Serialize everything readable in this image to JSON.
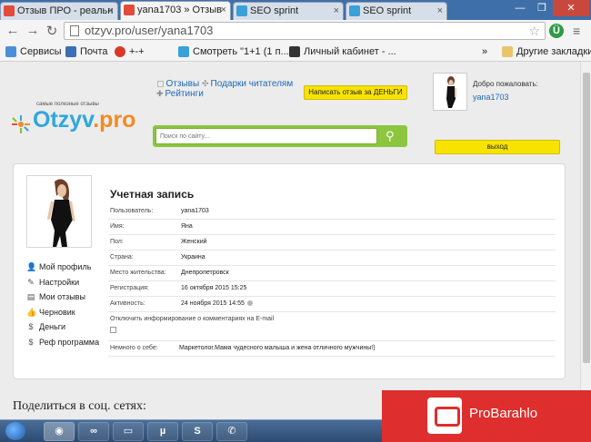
{
  "browser": {
    "tabs": [
      {
        "label": "Отзыв ПРО - реальн",
        "favicon_color": "#e24b3b",
        "active": false
      },
      {
        "label": "yana1703 » Отзыв",
        "favicon_color": "#e24b3b",
        "active": true
      },
      {
        "label": "SEO sprint",
        "favicon_color": "#3aa0d8",
        "active": false
      },
      {
        "label": "SEO sprint",
        "favicon_color": "#3aa0d8",
        "active": false
      }
    ],
    "url": "otzyv.pro/user/yana1703",
    "bookmarks": [
      {
        "label": "Сервисы",
        "color": "#4a8fdc"
      },
      {
        "label": "Почта",
        "color": "#3b6fb6"
      },
      {
        "label": "+-+",
        "color": "#d83a2a"
      },
      {
        "label": "Смотреть \"1+1 (1 п...",
        "color": "#3aa0d8"
      },
      {
        "label": "Личный кабинет - ...",
        "color": "#333333"
      }
    ],
    "other_bookmarks": "Другие закладки",
    "more": "»"
  },
  "site": {
    "logo_tagline": "самые полезные отзывы",
    "logo_main": "Otzyv",
    "logo_suffix": ".pro",
    "links": {
      "reviews": "Отзывы",
      "gifts": "Подарки читателям",
      "ratings": "Рейтинги"
    },
    "write_button": "Написать отзыв за ДЕНЬГИ",
    "welcome": "Добро пожаловать:",
    "welcome_user": "yana1703",
    "logout_button": "выход",
    "search_placeholder": "Поиск по сайту..."
  },
  "profile": {
    "title": "Учетная запись",
    "menu": [
      {
        "label": "Мой профиль",
        "icon": "user-icon"
      },
      {
        "label": "Настройки",
        "icon": "wrench-icon"
      },
      {
        "label": "Мои отзывы",
        "icon": "reviews-icon"
      },
      {
        "label": "Черновик",
        "icon": "draft-icon"
      },
      {
        "label": "Деньги",
        "icon": "money-icon"
      },
      {
        "label": "Реф программа",
        "icon": "referral-icon"
      }
    ],
    "fields": [
      {
        "label": "Пользователь:",
        "value": "yana1703"
      },
      {
        "label": "Имя:",
        "value": "Яна"
      },
      {
        "label": "Пол:",
        "value": "Женский"
      },
      {
        "label": "Страна:",
        "value": "Украина"
      },
      {
        "label": "Место жительства:",
        "value": "Днепропетровск"
      },
      {
        "label": "Регистрация:",
        "value": "16 октября 2015 15:25"
      },
      {
        "label": "Активность:",
        "value": "24 ноября 2015 14:55"
      }
    ],
    "notify_label": "Отключить информирование о комментариях на E-mail",
    "about_label": "Немного о себе:",
    "about_value": "Маркетолог.Мама чудесного малыша и жена отличного мужчины!)"
  },
  "share_title": "Поделиться в соц. сетях:",
  "watermark": "ProBarahlo"
}
